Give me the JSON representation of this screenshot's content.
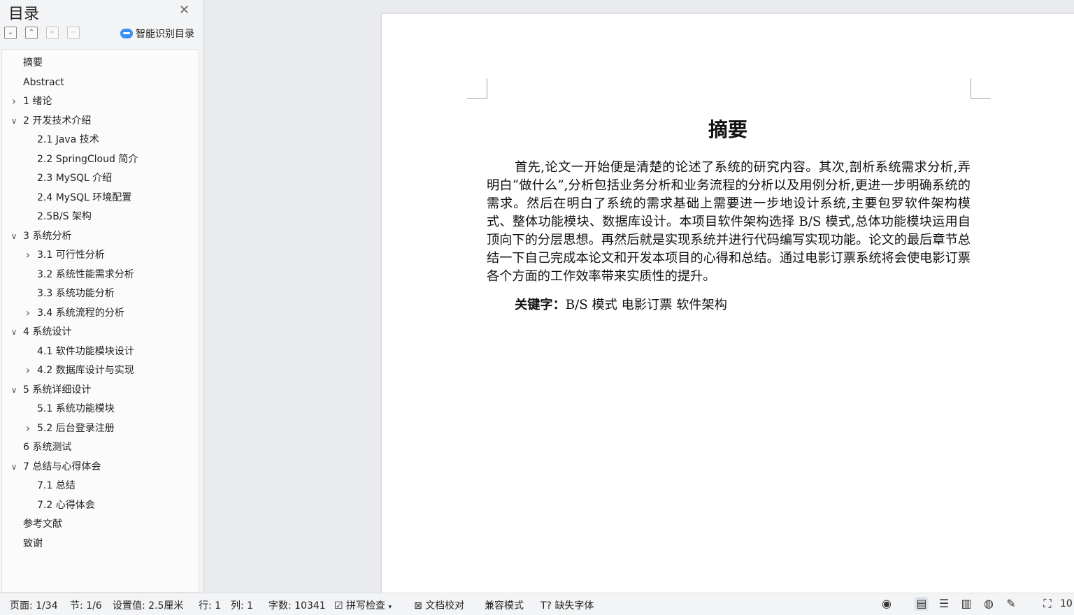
{
  "sidebar": {
    "title": "目录",
    "smart_label": "智能识别目录",
    "items": [
      {
        "label": "摘要",
        "level": 0,
        "chevron": ""
      },
      {
        "label": "Abstract",
        "level": 0,
        "chevron": ""
      },
      {
        "label": "1 绪论",
        "level": 0,
        "chevron": "right"
      },
      {
        "label": "2 开发技术介绍",
        "level": 0,
        "chevron": "down"
      },
      {
        "label": "2.1 Java 技术",
        "level": 1,
        "chevron": ""
      },
      {
        "label": "2.2 SpringCloud 简介",
        "level": 1,
        "chevron": ""
      },
      {
        "label": "2.3 MySQL 介绍",
        "level": 1,
        "chevron": ""
      },
      {
        "label": "2.4 MySQL 环境配置",
        "level": 1,
        "chevron": ""
      },
      {
        "label": "2.5B/S 架构",
        "level": 1,
        "chevron": ""
      },
      {
        "label": "3 系统分析",
        "level": 0,
        "chevron": "down"
      },
      {
        "label": "3.1 可行性分析",
        "level": 1,
        "chevron": "right"
      },
      {
        "label": "3.2 系统性能需求分析",
        "level": 1,
        "chevron": ""
      },
      {
        "label": "3.3 系统功能分析",
        "level": 1,
        "chevron": ""
      },
      {
        "label": "3.4 系统流程的分析",
        "level": 1,
        "chevron": "right"
      },
      {
        "label": "4 系统设计",
        "level": 0,
        "chevron": "down"
      },
      {
        "label": "4.1  软件功能模块设计",
        "level": 1,
        "chevron": ""
      },
      {
        "label": "4.2  数据库设计与实现",
        "level": 1,
        "chevron": "right"
      },
      {
        "label": "5 系统详细设计",
        "level": 0,
        "chevron": "down"
      },
      {
        "label": "5.1 系统功能模块",
        "level": 1,
        "chevron": ""
      },
      {
        "label": "5.2 后台登录注册",
        "level": 1,
        "chevron": "right"
      },
      {
        "label": "6 系统测试",
        "level": 0,
        "chevron": ""
      },
      {
        "label": "7 总结与心得体会",
        "level": 0,
        "chevron": "down"
      },
      {
        "label": "7.1  总结",
        "level": 1,
        "chevron": ""
      },
      {
        "label": "7.2  心得体会",
        "level": 1,
        "chevron": ""
      },
      {
        "label": "参考文献",
        "level": 0,
        "chevron": ""
      },
      {
        "label": "致谢",
        "level": 0,
        "chevron": ""
      }
    ]
  },
  "document": {
    "title": "摘要",
    "paragraph": "首先,论文一开始便是清楚的论述了系统的研究内容。其次,剖析系统需求分析,弄明白“做什么”,分析包括业务分析和业务流程的分析以及用例分析,更进一步明确系统的需求。然后在明白了系统的需求基础上需要进一步地设计系统,主要包罗软件架构模式、整体功能模块、数据库设计。本项目软件架构选择 B/S 模式,总体功能模块运用自顶向下的分层思想。再然后就是实现系统并进行代码编写实现功能。论文的最后章节总结一下自己完成本论文和开发本项目的心得和总结。通过电影订票系统将会使电影订票各个方面的工作效率带来实质性的提升。",
    "keywords_label": "关键字：",
    "keywords": "B/S 模式  电影订票  软件架构"
  },
  "statusbar": {
    "page": "页面: 1/34",
    "section": "节: 1/6",
    "setting": "设置值: 2.5厘米",
    "row": "行: 1",
    "col": "列: 1",
    "words": "字数: 10341",
    "spell": "拼写检查",
    "proof": "文档校对",
    "compat": "兼容模式",
    "missing_font": "缺失字体",
    "zoom": "10"
  }
}
